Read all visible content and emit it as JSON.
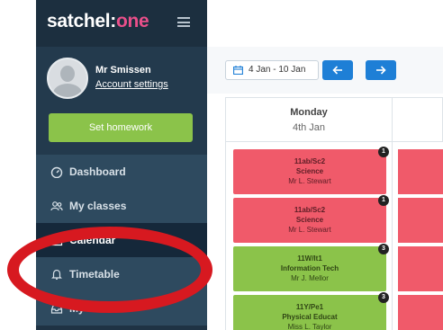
{
  "app": {
    "brand_prefix": "satchel:",
    "brand_accent": "one",
    "accent_color": "#e94f8a",
    "menu_icon": "hamburger-icon"
  },
  "user": {
    "name": "Mr Smissen",
    "account_link": "Account settings",
    "avatar_icon": "user-avatar-icon"
  },
  "actions": {
    "set_homework": "Set homework",
    "set_homework_color": "#8bc34a"
  },
  "nav": {
    "items": [
      {
        "label": "Dashboard",
        "icon": "gauge-icon"
      },
      {
        "label": "My classes",
        "icon": "people-icon"
      },
      {
        "label": "Calendar",
        "icon": "calendar-icon"
      },
      {
        "label": "Timetable",
        "icon": "bell-icon"
      },
      {
        "label": "My",
        "icon": "inbox-icon"
      }
    ]
  },
  "toolbar": {
    "date_range": "4 Jan - 10 Jan",
    "prev_icon": "arrow-left-icon",
    "next_icon": "arrow-right-icon",
    "button_color": "#1e7fd6"
  },
  "timetable": {
    "day_name": "Monday",
    "day_date": "4th Jan",
    "lessons": [
      {
        "class": "11ab/Sc2",
        "subject": "Science",
        "teacher": "Mr L. Stewart",
        "badge": "1",
        "color": "red"
      },
      {
        "class": "11ab/Sc2",
        "subject": "Science",
        "teacher": "Mr L. Stewart",
        "badge": "1",
        "color": "red"
      },
      {
        "class": "11W/It1",
        "subject": "Information Tech",
        "teacher": "Mr J. Mellor",
        "badge": "3",
        "color": "green"
      },
      {
        "class": "11Y/Pe1",
        "subject": "Physical Educat",
        "teacher": "Miss L. Taylor",
        "badge": "3",
        "color": "green"
      }
    ],
    "colors": {
      "red": "#f05a6a",
      "green": "#8bc34a"
    }
  },
  "annotation": {
    "color": "#d71920"
  }
}
